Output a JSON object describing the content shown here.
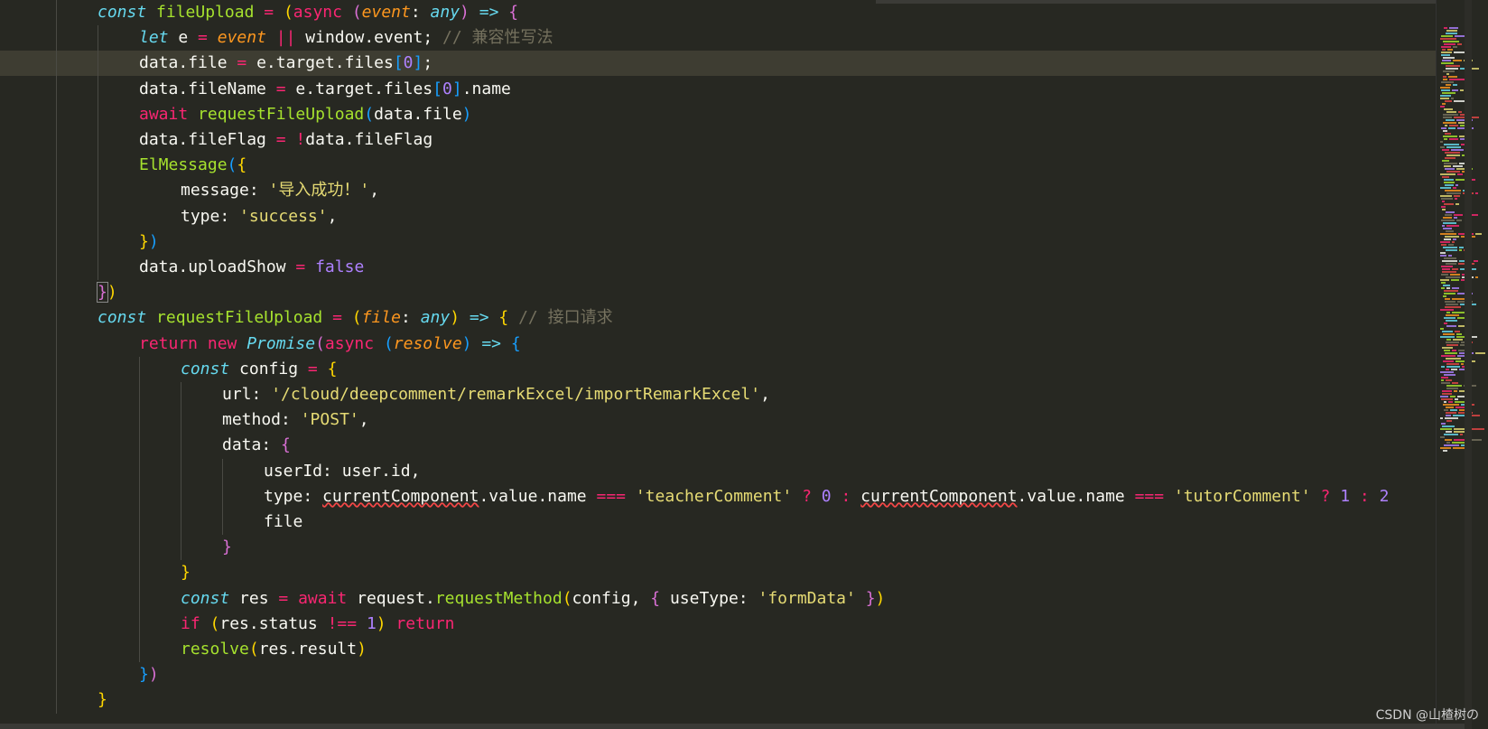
{
  "lines": [
    {
      "indent": 108,
      "tokens": [
        {
          "t": "const ",
          "c": "tok-kw-italic"
        },
        {
          "t": "fileUpload ",
          "c": "tok-fn"
        },
        {
          "t": "= ",
          "c": "tok-op"
        },
        {
          "t": "(",
          "c": "tok-b1"
        },
        {
          "t": "async ",
          "c": "tok-kw"
        },
        {
          "t": "(",
          "c": "tok-b2"
        },
        {
          "t": "event",
          "c": "tok-param"
        },
        {
          "t": ": ",
          "c": "tok-var"
        },
        {
          "t": "any",
          "c": "tok-type"
        },
        {
          "t": ") ",
          "c": "tok-b2"
        },
        {
          "t": "=> ",
          "c": "tok-kw-italic"
        },
        {
          "t": "{",
          "c": "tok-b2"
        }
      ]
    },
    {
      "indent": 154,
      "tokens": [
        {
          "t": "let ",
          "c": "tok-kw-italic"
        },
        {
          "t": "e ",
          "c": "tok-var"
        },
        {
          "t": "= ",
          "c": "tok-op"
        },
        {
          "t": "event ",
          "c": "tok-param"
        },
        {
          "t": "|| ",
          "c": "tok-op"
        },
        {
          "t": "window",
          "c": "tok-var"
        },
        {
          "t": ".",
          "c": "tok-var"
        },
        {
          "t": "event",
          "c": "tok-var"
        },
        {
          "t": "; ",
          "c": "tok-var"
        },
        {
          "t": "// 兼容性写法",
          "c": "tok-comment"
        }
      ]
    },
    {
      "indent": 154,
      "current": true,
      "tokens": [
        {
          "t": "data",
          "c": "tok-var"
        },
        {
          "t": ".file ",
          "c": "tok-var"
        },
        {
          "t": "= ",
          "c": "tok-op"
        },
        {
          "t": "e",
          "c": "tok-var"
        },
        {
          "t": ".target.files",
          "c": "tok-var"
        },
        {
          "t": "[",
          "c": "tok-b3"
        },
        {
          "t": "0",
          "c": "tok-num"
        },
        {
          "t": "]",
          "c": "tok-b3"
        },
        {
          "t": ";",
          "c": "tok-var"
        }
      ]
    },
    {
      "indent": 154,
      "tokens": [
        {
          "t": "data",
          "c": "tok-var"
        },
        {
          "t": ".fileName ",
          "c": "tok-var"
        },
        {
          "t": "= ",
          "c": "tok-op"
        },
        {
          "t": "e",
          "c": "tok-var"
        },
        {
          "t": ".target.files",
          "c": "tok-var"
        },
        {
          "t": "[",
          "c": "tok-b3"
        },
        {
          "t": "0",
          "c": "tok-num"
        },
        {
          "t": "]",
          "c": "tok-b3"
        },
        {
          "t": ".name",
          "c": "tok-var"
        }
      ]
    },
    {
      "indent": 154,
      "tokens": [
        {
          "t": "await ",
          "c": "tok-kw"
        },
        {
          "t": "requestFileUpload",
          "c": "tok-fn"
        },
        {
          "t": "(",
          "c": "tok-b3"
        },
        {
          "t": "data",
          "c": "tok-var"
        },
        {
          "t": ".file",
          "c": "tok-var"
        },
        {
          "t": ")",
          "c": "tok-b3"
        }
      ]
    },
    {
      "indent": 154,
      "tokens": [
        {
          "t": "data",
          "c": "tok-var"
        },
        {
          "t": ".fileFlag ",
          "c": "tok-var"
        },
        {
          "t": "= ",
          "c": "tok-op"
        },
        {
          "t": "!",
          "c": "tok-op"
        },
        {
          "t": "data",
          "c": "tok-var"
        },
        {
          "t": ".fileFlag",
          "c": "tok-var"
        }
      ]
    },
    {
      "indent": 154,
      "tokens": [
        {
          "t": "ElMessage",
          "c": "tok-fn"
        },
        {
          "t": "(",
          "c": "tok-b3"
        },
        {
          "t": "{",
          "c": "tok-b1"
        }
      ]
    },
    {
      "indent": 200,
      "tokens": [
        {
          "t": "message",
          "c": "tok-var"
        },
        {
          "t": ": ",
          "c": "tok-var"
        },
        {
          "t": "'导入成功！'",
          "c": "tok-str"
        },
        {
          "t": ",",
          "c": "tok-var"
        }
      ]
    },
    {
      "indent": 200,
      "tokens": [
        {
          "t": "type",
          "c": "tok-var"
        },
        {
          "t": ": ",
          "c": "tok-var"
        },
        {
          "t": "'success'",
          "c": "tok-str"
        },
        {
          "t": ",",
          "c": "tok-var"
        }
      ]
    },
    {
      "indent": 154,
      "tokens": [
        {
          "t": "}",
          "c": "tok-b1"
        },
        {
          "t": ")",
          "c": "tok-b3"
        }
      ]
    },
    {
      "indent": 154,
      "tokens": [
        {
          "t": "data",
          "c": "tok-var"
        },
        {
          "t": ".uploadShow ",
          "c": "tok-var"
        },
        {
          "t": "= ",
          "c": "tok-op"
        },
        {
          "t": "false",
          "c": "tok-bool"
        }
      ]
    },
    {
      "indent": 108,
      "tokens": [
        {
          "t": "}",
          "c": "tok-b2 bracket-box"
        },
        {
          "t": ")",
          "c": "tok-b1"
        }
      ]
    },
    {
      "indent": 108,
      "tokens": [
        {
          "t": "const ",
          "c": "tok-kw-italic"
        },
        {
          "t": "requestFileUpload ",
          "c": "tok-fn"
        },
        {
          "t": "= ",
          "c": "tok-op"
        },
        {
          "t": "(",
          "c": "tok-b1"
        },
        {
          "t": "file",
          "c": "tok-param"
        },
        {
          "t": ": ",
          "c": "tok-var"
        },
        {
          "t": "any",
          "c": "tok-type"
        },
        {
          "t": ") ",
          "c": "tok-b1"
        },
        {
          "t": "=> ",
          "c": "tok-kw-italic"
        },
        {
          "t": "{ ",
          "c": "tok-b1"
        },
        {
          "t": "// 接口请求",
          "c": "tok-comment"
        }
      ]
    },
    {
      "indent": 154,
      "tokens": [
        {
          "t": "return ",
          "c": "tok-kw"
        },
        {
          "t": "new ",
          "c": "tok-kw"
        },
        {
          "t": "Promise",
          "c": "tok-cls"
        },
        {
          "t": "(",
          "c": "tok-b2"
        },
        {
          "t": "async ",
          "c": "tok-kw"
        },
        {
          "t": "(",
          "c": "tok-b3"
        },
        {
          "t": "resolve",
          "c": "tok-param"
        },
        {
          "t": ") ",
          "c": "tok-b3"
        },
        {
          "t": "=> ",
          "c": "tok-kw-italic"
        },
        {
          "t": "{",
          "c": "tok-b3"
        }
      ]
    },
    {
      "indent": 200,
      "tokens": [
        {
          "t": "const ",
          "c": "tok-kw-italic"
        },
        {
          "t": "config ",
          "c": "tok-var"
        },
        {
          "t": "= ",
          "c": "tok-op"
        },
        {
          "t": "{",
          "c": "tok-b1"
        }
      ]
    },
    {
      "indent": 246,
      "tokens": [
        {
          "t": "url",
          "c": "tok-var"
        },
        {
          "t": ": ",
          "c": "tok-var"
        },
        {
          "t": "'/cloud/deepcomment/remarkExcel/importRemarkExcel'",
          "c": "tok-str"
        },
        {
          "t": ",",
          "c": "tok-var"
        }
      ]
    },
    {
      "indent": 246,
      "tokens": [
        {
          "t": "method",
          "c": "tok-var"
        },
        {
          "t": ": ",
          "c": "tok-var"
        },
        {
          "t": "'POST'",
          "c": "tok-str"
        },
        {
          "t": ",",
          "c": "tok-var"
        }
      ]
    },
    {
      "indent": 246,
      "tokens": [
        {
          "t": "data",
          "c": "tok-var"
        },
        {
          "t": ": ",
          "c": "tok-var"
        },
        {
          "t": "{",
          "c": "tok-b2"
        }
      ]
    },
    {
      "indent": 292,
      "tokens": [
        {
          "t": "userId",
          "c": "tok-var"
        },
        {
          "t": ": ",
          "c": "tok-var"
        },
        {
          "t": "user",
          "c": "tok-var"
        },
        {
          "t": ".id,",
          "c": "tok-var"
        }
      ]
    },
    {
      "indent": 292,
      "tokens": [
        {
          "t": "type",
          "c": "tok-var"
        },
        {
          "t": ": ",
          "c": "tok-var"
        },
        {
          "t": "currentComponent",
          "c": "tok-var tok-squiggle"
        },
        {
          "t": ".value.name ",
          "c": "tok-var"
        },
        {
          "t": "=== ",
          "c": "tok-op"
        },
        {
          "t": "'teacherComment' ",
          "c": "tok-str"
        },
        {
          "t": "? ",
          "c": "tok-op"
        },
        {
          "t": "0 ",
          "c": "tok-num"
        },
        {
          "t": ": ",
          "c": "tok-op"
        },
        {
          "t": "currentComponent",
          "c": "tok-var tok-squiggle"
        },
        {
          "t": ".value.name ",
          "c": "tok-var"
        },
        {
          "t": "=== ",
          "c": "tok-op"
        },
        {
          "t": "'tutorComment' ",
          "c": "tok-str"
        },
        {
          "t": "? ",
          "c": "tok-op"
        },
        {
          "t": "1 ",
          "c": "tok-num"
        },
        {
          "t": ": ",
          "c": "tok-op"
        },
        {
          "t": "2",
          "c": "tok-num"
        }
      ]
    },
    {
      "indent": 292,
      "tokens": [
        {
          "t": "file",
          "c": "tok-var"
        }
      ]
    },
    {
      "indent": 246,
      "tokens": [
        {
          "t": "}",
          "c": "tok-b2"
        }
      ]
    },
    {
      "indent": 200,
      "tokens": [
        {
          "t": "}",
          "c": "tok-b1"
        }
      ]
    },
    {
      "indent": 200,
      "tokens": [
        {
          "t": "const ",
          "c": "tok-kw-italic"
        },
        {
          "t": "res ",
          "c": "tok-var"
        },
        {
          "t": "= ",
          "c": "tok-op"
        },
        {
          "t": "await ",
          "c": "tok-kw"
        },
        {
          "t": "request",
          "c": "tok-var"
        },
        {
          "t": ".",
          "c": "tok-var"
        },
        {
          "t": "requestMethod",
          "c": "tok-fn"
        },
        {
          "t": "(",
          "c": "tok-b1"
        },
        {
          "t": "config, ",
          "c": "tok-var"
        },
        {
          "t": "{ ",
          "c": "tok-b2"
        },
        {
          "t": "useType",
          "c": "tok-var"
        },
        {
          "t": ": ",
          "c": "tok-var"
        },
        {
          "t": "'formData' ",
          "c": "tok-str"
        },
        {
          "t": "}",
          "c": "tok-b2"
        },
        {
          "t": ")",
          "c": "tok-b1"
        }
      ]
    },
    {
      "indent": 200,
      "tokens": [
        {
          "t": "if ",
          "c": "tok-kw"
        },
        {
          "t": "(",
          "c": "tok-b1"
        },
        {
          "t": "res",
          "c": "tok-var"
        },
        {
          "t": ".status ",
          "c": "tok-var"
        },
        {
          "t": "!== ",
          "c": "tok-op"
        },
        {
          "t": "1",
          "c": "tok-num"
        },
        {
          "t": ") ",
          "c": "tok-b1"
        },
        {
          "t": "return",
          "c": "tok-kw"
        }
      ]
    },
    {
      "indent": 200,
      "tokens": [
        {
          "t": "resolve",
          "c": "tok-fn"
        },
        {
          "t": "(",
          "c": "tok-b1"
        },
        {
          "t": "res",
          "c": "tok-var"
        },
        {
          "t": ".result",
          "c": "tok-var"
        },
        {
          "t": ")",
          "c": "tok-b1"
        }
      ]
    },
    {
      "indent": 154,
      "tokens": [
        {
          "t": "}",
          "c": "tok-b3"
        },
        {
          "t": ")",
          "c": "tok-b2"
        }
      ]
    },
    {
      "indent": 108,
      "tokens": [
        {
          "t": "}",
          "c": "tok-b1"
        }
      ]
    }
  ],
  "watermark": "CSDN @山楂树の"
}
